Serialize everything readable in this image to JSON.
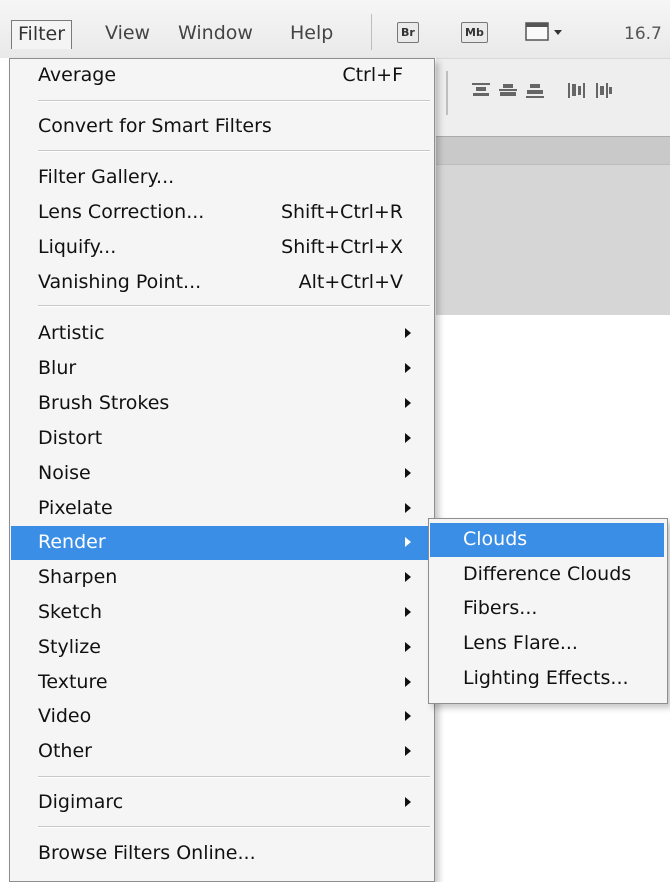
{
  "menubar": {
    "items": [
      "Filter",
      "View",
      "Window",
      "Help"
    ],
    "icons": [
      {
        "label": "Br",
        "name": "bridge-icon"
      },
      {
        "label": "Mb",
        "name": "minibridge-icon"
      }
    ],
    "zoom": "16.7"
  },
  "filter_menu": {
    "groups": [
      [
        {
          "label": "Average",
          "shortcut": "Ctrl+F"
        }
      ],
      [
        {
          "label": "Convert for Smart Filters"
        }
      ],
      [
        {
          "label": "Filter Gallery..."
        },
        {
          "label": "Lens Correction...",
          "shortcut": "Shift+Ctrl+R"
        },
        {
          "label": "Liquify...",
          "shortcut": "Shift+Ctrl+X"
        },
        {
          "label": "Vanishing Point...",
          "shortcut": "Alt+Ctrl+V"
        }
      ],
      [
        {
          "label": "Artistic",
          "submenu": true
        },
        {
          "label": "Blur",
          "submenu": true
        },
        {
          "label": "Brush Strokes",
          "submenu": true
        },
        {
          "label": "Distort",
          "submenu": true
        },
        {
          "label": "Noise",
          "submenu": true
        },
        {
          "label": "Pixelate",
          "submenu": true
        },
        {
          "label": "Render",
          "submenu": true,
          "highlighted": true
        },
        {
          "label": "Sharpen",
          "submenu": true
        },
        {
          "label": "Sketch",
          "submenu": true
        },
        {
          "label": "Stylize",
          "submenu": true
        },
        {
          "label": "Texture",
          "submenu": true
        },
        {
          "label": "Video",
          "submenu": true
        },
        {
          "label": "Other",
          "submenu": true
        }
      ],
      [
        {
          "label": "Digimarc",
          "submenu": true
        }
      ],
      [
        {
          "label": "Browse Filters Online..."
        }
      ]
    ]
  },
  "render_submenu": {
    "items": [
      {
        "label": "Clouds",
        "highlighted": true
      },
      {
        "label": "Difference Clouds"
      },
      {
        "label": "Fibers..."
      },
      {
        "label": "Lens Flare..."
      },
      {
        "label": "Lighting Effects..."
      }
    ]
  },
  "colors": {
    "highlight": "#3a8ee6",
    "menu_bg": "#f5f5f5"
  }
}
